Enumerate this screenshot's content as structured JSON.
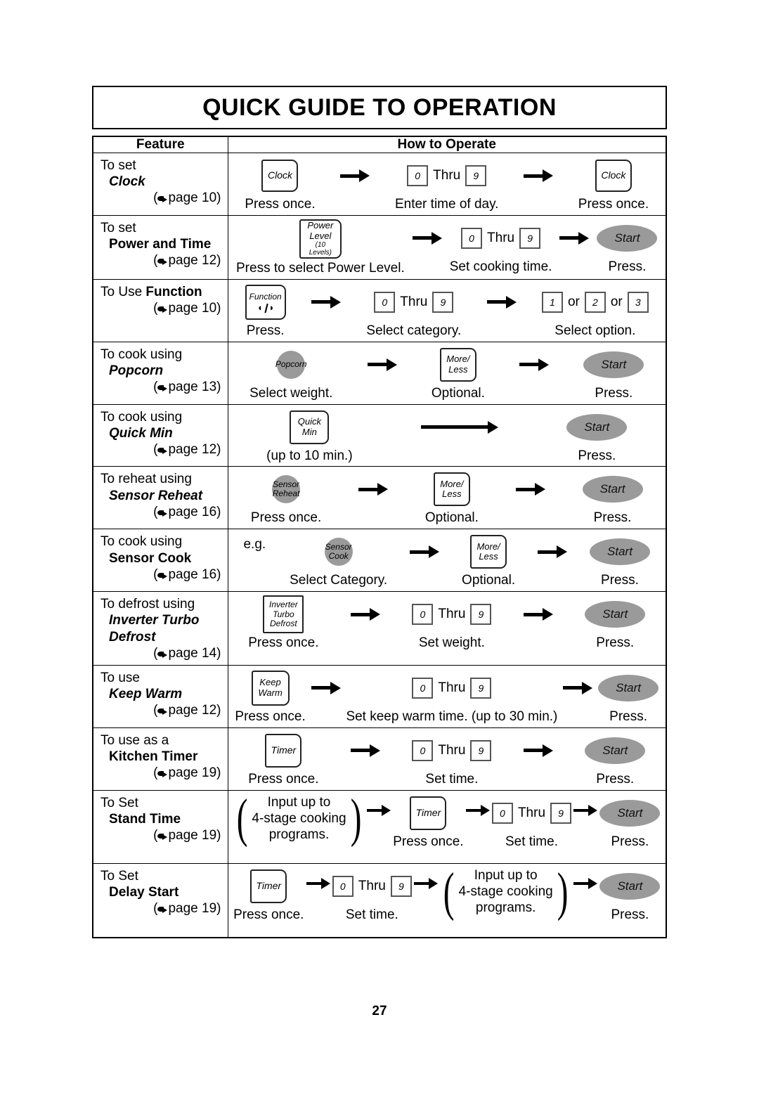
{
  "title": "QUICK GUIDE TO OPERATION",
  "folio": "27",
  "columns": {
    "feature": "Feature",
    "how": "How to Operate"
  },
  "labels": {
    "thru": "Thru",
    "or": "or",
    "start": "Start",
    "press": "Press.",
    "press_once": "Press once.",
    "optional": "Optional.",
    "set_time": "Set time.",
    "eg": "e.g.",
    "page_word": "page"
  },
  "rows": [
    {
      "lead": "To set",
      "name": "Clock",
      "name_italic": true,
      "page": "(page 10)",
      "page_num": "10",
      "steps": [
        {
          "ctrl": "button-clock",
          "button": {
            "lines": [
              "Clock"
            ]
          },
          "caption": "Press once."
        },
        {
          "ctrl": "numeric-keys",
          "keys": {
            "from": "0",
            "mid": "Thru",
            "to": "9"
          },
          "caption": "Enter time of day."
        },
        {
          "ctrl": "button-clock",
          "button": {
            "lines": [
              "Clock"
            ]
          },
          "caption": "Press once."
        }
      ]
    },
    {
      "lead": "To set",
      "name": "Power and Time",
      "name_italic": false,
      "page": "(page 12)",
      "page_num": "12",
      "steps": [
        {
          "ctrl": "button-power-level",
          "button": {
            "lines": [
              "Power",
              "Level"
            ],
            "tiny": "(10 Levels)"
          },
          "caption": "Press to select Power Level."
        },
        {
          "ctrl": "numeric-keys",
          "keys": {
            "from": "0",
            "mid": "Thru",
            "to": "9"
          },
          "caption": "Set cooking time."
        },
        {
          "ctrl": "button-start",
          "button": {
            "lines": [
              "Start"
            ]
          },
          "caption": "Press."
        }
      ]
    },
    {
      "lead": "To Use",
      "name": "Function",
      "name_inline": true,
      "name_italic": false,
      "page": "(page 10)",
      "page_num": "10",
      "steps": [
        {
          "ctrl": "button-function",
          "button": {
            "lines": [
              "Function"
            ],
            "glyph": "function-icon"
          },
          "caption": "Press."
        },
        {
          "ctrl": "numeric-keys",
          "keys": {
            "from": "0",
            "mid": "Thru",
            "to": "9"
          },
          "caption": "Select category."
        },
        {
          "ctrl": "option-keys",
          "options": [
            "1",
            "2",
            "3"
          ],
          "caption": "Select option."
        }
      ]
    },
    {
      "lead": "To cook using",
      "name": "Popcorn",
      "name_italic": true,
      "page": "(page 13)",
      "page_num": "13",
      "steps": [
        {
          "ctrl": "button-circle",
          "button": {
            "lines": [
              "Popcorn"
            ]
          },
          "caption": "Select weight."
        },
        {
          "ctrl": "button-more-less",
          "button": {
            "lines": [
              "More/",
              "Less"
            ]
          },
          "caption": "Optional."
        },
        {
          "ctrl": "button-start",
          "button": {
            "lines": [
              "Start"
            ]
          },
          "caption": "Press."
        }
      ]
    },
    {
      "lead": "To cook using",
      "name": "Quick Min",
      "name_italic": true,
      "page": "(page 12)",
      "page_num": "12",
      "steps": [
        {
          "ctrl": "button-quick-min",
          "button": {
            "lines": [
              "Quick",
              "Min"
            ]
          },
          "caption": "(up to 10 min.)"
        },
        {
          "ctrl": "long-arrow",
          "caption": ""
        },
        {
          "ctrl": "button-start",
          "button": {
            "lines": [
              "Start"
            ]
          },
          "caption": "Press."
        }
      ]
    },
    {
      "lead": "To reheat using",
      "name": "Sensor Reheat",
      "name_italic": true,
      "page": "(page 16)",
      "page_num": "16",
      "steps": [
        {
          "ctrl": "button-circle",
          "button": {
            "lines": [
              "Sensor",
              "Reheat"
            ]
          },
          "caption": "Press once."
        },
        {
          "ctrl": "button-more-less",
          "button": {
            "lines": [
              "More/",
              "Less"
            ]
          },
          "caption": "Optional."
        },
        {
          "ctrl": "button-start",
          "button": {
            "lines": [
              "Start"
            ]
          },
          "caption": "Press."
        }
      ]
    },
    {
      "lead": "To cook using",
      "name": "Sensor Cook",
      "name_italic": false,
      "page": "(page 16)",
      "page_num": "16",
      "prefix": "e.g.",
      "steps": [
        {
          "ctrl": "button-circle",
          "button": {
            "lines": [
              "Sensor",
              "Cook"
            ]
          },
          "caption": "Select Category."
        },
        {
          "ctrl": "button-more-less",
          "button": {
            "lines": [
              "More/",
              "Less"
            ]
          },
          "caption": "Optional."
        },
        {
          "ctrl": "button-start",
          "button": {
            "lines": [
              "Start"
            ]
          },
          "caption": "Press."
        }
      ]
    },
    {
      "lead": "To defrost using",
      "name": "Inverter Turbo",
      "name2": "Defrost",
      "name_italic": true,
      "page": "(page 14)",
      "page_num": "14",
      "steps": [
        {
          "ctrl": "button-defrost",
          "button": {
            "lines": [
              "Inverter",
              "Turbo",
              "Defrost"
            ]
          },
          "caption": "Press once."
        },
        {
          "ctrl": "numeric-keys",
          "keys": {
            "from": "0",
            "mid": "Thru",
            "to": "9"
          },
          "caption": "Set weight."
        },
        {
          "ctrl": "button-start",
          "button": {
            "lines": [
              "Start"
            ]
          },
          "caption": "Press."
        }
      ]
    },
    {
      "lead": "To use",
      "name": "Keep Warm",
      "name_italic": true,
      "page": "(page 12)",
      "page_num": "12",
      "steps": [
        {
          "ctrl": "button-keep-warm",
          "button": {
            "lines": [
              "Keep",
              "Warm"
            ]
          },
          "caption": "Press once."
        },
        {
          "ctrl": "numeric-keys",
          "keys": {
            "from": "0",
            "mid": "Thru",
            "to": "9"
          },
          "caption": "Set keep warm time. (up to 30 min.)"
        },
        {
          "ctrl": "button-start",
          "button": {
            "lines": [
              "Start"
            ]
          },
          "caption": "Press."
        }
      ]
    },
    {
      "lead": "To use as a",
      "name": "Kitchen Timer",
      "name_italic": false,
      "page": "(page 19)",
      "page_num": "19",
      "steps": [
        {
          "ctrl": "button-timer",
          "button": {
            "lines": [
              "Timer"
            ]
          },
          "caption": "Press once."
        },
        {
          "ctrl": "numeric-keys",
          "keys": {
            "from": "0",
            "mid": "Thru",
            "to": "9"
          },
          "caption": "Set time."
        },
        {
          "ctrl": "button-start",
          "button": {
            "lines": [
              "Start"
            ]
          },
          "caption": "Press."
        }
      ]
    },
    {
      "lead": "To Set",
      "name": "Stand Time",
      "name_italic": false,
      "page": "(page 19)",
      "page_num": "19",
      "steps": [
        {
          "ctrl": "bracket-group",
          "bracket": [
            "Input up to",
            "4-stage cooking",
            "programs."
          ],
          "caption": ""
        },
        {
          "ctrl": "button-timer",
          "button": {
            "lines": [
              "Timer"
            ]
          },
          "caption": "Press once."
        },
        {
          "ctrl": "numeric-keys",
          "keys": {
            "from": "0",
            "mid": "Thru",
            "to": "9"
          },
          "caption": "Set time."
        },
        {
          "ctrl": "button-start",
          "button": {
            "lines": [
              "Start"
            ]
          },
          "caption": "Press."
        }
      ]
    },
    {
      "lead": "To Set",
      "name": "Delay Start",
      "name_italic": false,
      "page": "(page 19)",
      "page_num": "19",
      "steps": [
        {
          "ctrl": "button-timer",
          "button": {
            "lines": [
              "Timer"
            ]
          },
          "caption": "Press once."
        },
        {
          "ctrl": "numeric-keys",
          "keys": {
            "from": "0",
            "mid": "Thru",
            "to": "9"
          },
          "caption": "Set time."
        },
        {
          "ctrl": "bracket-group",
          "bracket": [
            "Input up to",
            "4-stage cooking",
            "programs."
          ],
          "caption": ""
        },
        {
          "ctrl": "button-start",
          "button": {
            "lines": [
              "Start"
            ]
          },
          "caption": "Press."
        }
      ]
    }
  ],
  "colors": {
    "button_gray": "#9a9a9a",
    "ink": "#000000",
    "paper": "#ffffff"
  }
}
